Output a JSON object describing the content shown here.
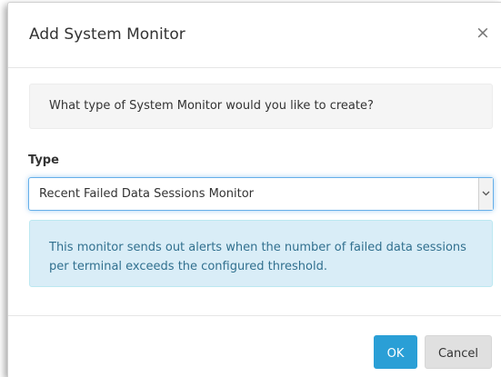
{
  "dialog": {
    "title": "Add System Monitor",
    "close_glyph": "×",
    "question": "What type of System Monitor would you like to create?",
    "type_label": "Type",
    "type_select": {
      "selected": "Recent Failed Data Sessions Monitor"
    },
    "info": "This monitor sends out alerts when the number of failed data sessions per terminal exceeds the configured threshold.",
    "ok_label": "OK",
    "cancel_label": "Cancel"
  },
  "icons": {
    "close": "close-icon",
    "dropdown": "chevron-down-icon"
  },
  "colors": {
    "primary": "#2a9fd6",
    "info_bg": "#d9edf7",
    "info_text": "#31708f",
    "focus_border": "#66afe9"
  }
}
